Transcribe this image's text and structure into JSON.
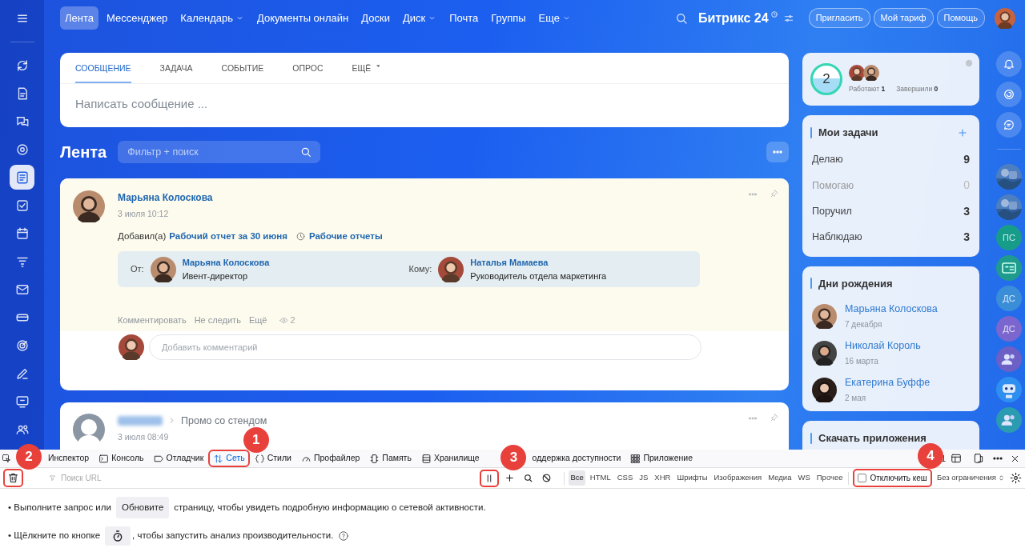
{
  "sidebar": {
    "items": [
      {
        "selected": false
      },
      {
        "selected": false
      },
      {
        "selected": false
      },
      {
        "selected": false
      },
      {
        "selected": true
      },
      {
        "selected": false
      },
      {
        "selected": false
      },
      {
        "selected": false
      },
      {
        "selected": false
      },
      {
        "selected": false
      },
      {
        "selected": false
      },
      {
        "selected": false
      },
      {
        "selected": false
      },
      {
        "selected": false
      }
    ]
  },
  "top_nav": {
    "items": [
      {
        "label": "Лента",
        "selected": true,
        "dropdown": false
      },
      {
        "label": "Мессенджер",
        "selected": false,
        "dropdown": false
      },
      {
        "label": "Календарь",
        "selected": false,
        "dropdown": true
      },
      {
        "label": "Документы онлайн",
        "selected": false,
        "dropdown": false
      },
      {
        "label": "Доски",
        "selected": false,
        "dropdown": false
      },
      {
        "label": "Диск",
        "selected": false,
        "dropdown": true
      },
      {
        "label": "Почта",
        "selected": false,
        "dropdown": false
      },
      {
        "label": "Группы",
        "selected": false,
        "dropdown": false
      },
      {
        "label": "Еще",
        "selected": false,
        "dropdown": true
      }
    ],
    "logo": "Битрикс 24",
    "buttons": [
      "Пригласить",
      "Мой тариф",
      "Помощь"
    ]
  },
  "composer": {
    "tabs": [
      {
        "label": "СООБЩЕНИЕ",
        "selected": true,
        "dropdown": false
      },
      {
        "label": "ЗАДАЧА",
        "selected": false,
        "dropdown": false
      },
      {
        "label": "СОБЫТИЕ",
        "selected": false,
        "dropdown": false
      },
      {
        "label": "ОПРОС",
        "selected": false,
        "dropdown": false
      },
      {
        "label": "ЕЩЁ",
        "selected": false,
        "dropdown": true
      }
    ],
    "placeholder": "Написать сообщение ..."
  },
  "feed": {
    "title": "Лента",
    "filter_placeholder": "Фильтр + поиск",
    "posts": [
      {
        "kind": "report",
        "author": "Марьяна Колоскова",
        "date": "3 июля 10:12",
        "added": "Добавил(а)",
        "report_link": "Рабочий отчет за 30 июня",
        "report_group": "Рабочие отчеты",
        "from_label": "От:",
        "from_name": "Марьяна Колоскова",
        "from_role": "Ивент-директор",
        "to_label": "Кому:",
        "to_name": "Наталья Мамаева",
        "to_role": "Руководитель отдела маркетинга",
        "actions": [
          "Комментировать",
          "Не следить",
          "Ещё"
        ],
        "views": "2",
        "comment_placeholder": "Добавить комментарий"
      },
      {
        "kind": "promo",
        "target": "Промо со стендом",
        "date": "3 июля 08:49"
      }
    ]
  },
  "right": {
    "workday": {
      "count": "2",
      "stats": [
        "Работают **1**",
        "Завершили **0**"
      ]
    },
    "tasks": {
      "title": "Мои задачи",
      "rows": [
        {
          "label": "Делаю",
          "count": "9",
          "muted": false
        },
        {
          "label": "Помогаю",
          "count": "0",
          "muted": true
        },
        {
          "label": "Поручил",
          "count": "3",
          "muted": false
        },
        {
          "label": "Наблюдаю",
          "count": "3",
          "muted": false
        }
      ]
    },
    "birthdays": {
      "title": "Дни рождения",
      "people": [
        {
          "name": "Марьяна Колоскова",
          "date": "7 декабря"
        },
        {
          "name": "Николай Король",
          "date": "16 марта"
        },
        {
          "name": "Екатерина Буффе",
          "date": "2 мая"
        }
      ]
    },
    "apps": {
      "title": "Скачать приложения"
    }
  },
  "right_rail": {
    "items": [
      {
        "kind": "bell"
      },
      {
        "kind": "spiral"
      },
      {
        "kind": "chat"
      },
      {
        "kind": "picture"
      },
      {
        "kind": "picture"
      },
      {
        "kind": "initials",
        "text": "ПС",
        "color": "#189c8a"
      },
      {
        "kind": "card",
        "color": "#1f9b8d"
      },
      {
        "kind": "initials",
        "text": "ДС",
        "color": "#3a8ed8"
      },
      {
        "kind": "initials",
        "text": "ДС",
        "color": "#7b66cf"
      },
      {
        "kind": "people",
        "color": "#6c5fc6"
      },
      {
        "kind": "robot",
        "color": "#2f8ff0"
      },
      {
        "kind": "people",
        "color": "#2a9bb0"
      }
    ]
  },
  "devtools": {
    "tabs": [
      {
        "label": "Инспектор",
        "selected": false
      },
      {
        "label": "Консоль",
        "selected": false
      },
      {
        "label": "Отладчик",
        "selected": false
      },
      {
        "label": "Сеть",
        "selected": true,
        "callout": "1"
      },
      {
        "label": "Стили",
        "selected": false
      },
      {
        "label": "Профайлер",
        "selected": false
      },
      {
        "label": "Память",
        "selected": false
      },
      {
        "label": "Хранилище",
        "selected": false
      },
      {
        "label": "оддержка доступности",
        "selected": false
      },
      {
        "label": "Приложение",
        "selected": false
      }
    ],
    "error_count": "1",
    "clear_callout": "2",
    "url_placeholder": "Поиск URL",
    "pause_callout": "3",
    "filters": [
      {
        "label": "Все",
        "selected": true
      },
      {
        "label": "HTML",
        "selected": false
      },
      {
        "label": "CSS",
        "selected": false
      },
      {
        "label": "JS",
        "selected": false
      },
      {
        "label": "XHR",
        "selected": false
      },
      {
        "label": "Шрифты",
        "selected": false
      },
      {
        "label": "Изображения",
        "selected": false
      },
      {
        "label": "Медиа",
        "selected": false
      },
      {
        "label": "WS",
        "selected": false
      },
      {
        "label": "Прочее",
        "selected": false
      }
    ],
    "disable_cache": {
      "label": "Отключить кеш",
      "checked": false,
      "callout": "4"
    },
    "throttling": "Без ограничения",
    "messages": [
      {
        "kind": "reload",
        "before": "• Выполните запрос или",
        "button": "Обновите",
        "after": "страницу, чтобы увидеть подробную информацию о сетевой активности."
      },
      {
        "kind": "perf",
        "before": "• Щёлкните по кнопке",
        "after": ", чтобы запустить анализ производительности."
      }
    ]
  }
}
